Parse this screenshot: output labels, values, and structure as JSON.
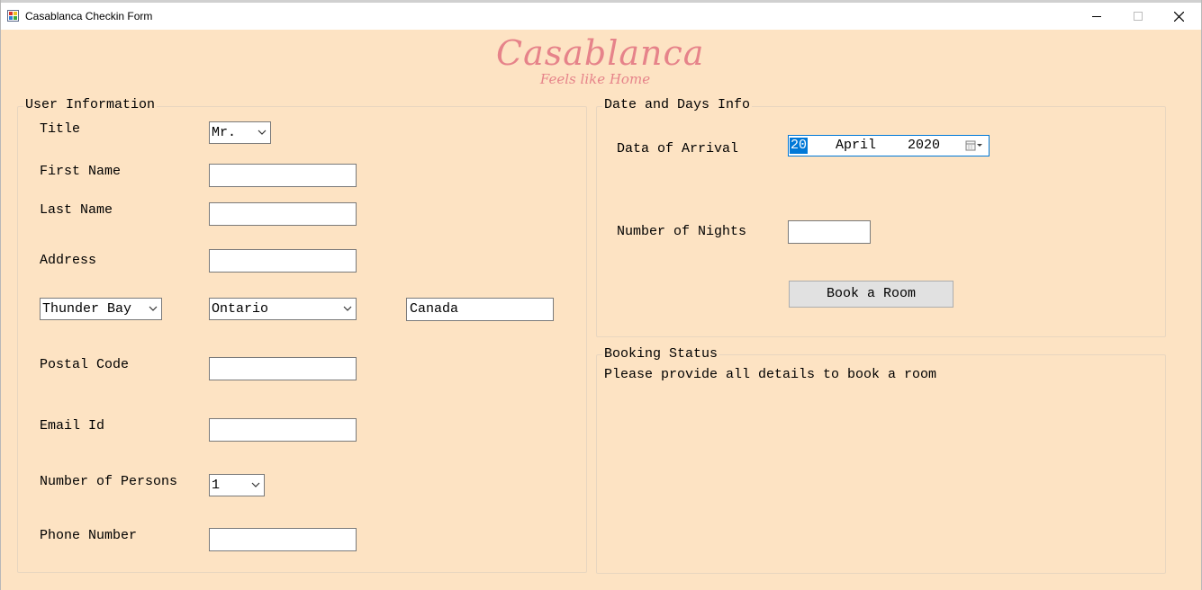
{
  "window": {
    "title": "Casablanca Checkin Form"
  },
  "logo": {
    "brand": "Casablanca",
    "tagline": "Feels like Home"
  },
  "user_info": {
    "legend": "User Information",
    "title_label": "Title",
    "title_value": "Mr.",
    "first_name_label": "First Name",
    "first_name_value": "",
    "last_name_label": "Last Name",
    "last_name_value": "",
    "address_label": "Address",
    "address_value": "",
    "city_value": "Thunder Bay",
    "province_value": "Ontario",
    "country_value": "Canada",
    "postal_code_label": "Postal Code",
    "postal_code_value": "",
    "email_label": "Email Id",
    "email_value": "",
    "persons_label": "Number of Persons",
    "persons_value": "1",
    "phone_label": "Phone Number",
    "phone_value": ""
  },
  "date_info": {
    "legend": "Date and Days Info",
    "arrival_label": "Data of Arrival",
    "arrival_day": "20",
    "arrival_month": "April",
    "arrival_year": "2020",
    "nights_label": "Number of Nights",
    "nights_value": "",
    "book_button": "Book a Room"
  },
  "booking_status": {
    "legend": "Booking Status",
    "message": "Please provide all details to book a room"
  },
  "colors": {
    "background": "#fde3c3",
    "brand": "#e6838a",
    "selection": "#0078d7"
  }
}
